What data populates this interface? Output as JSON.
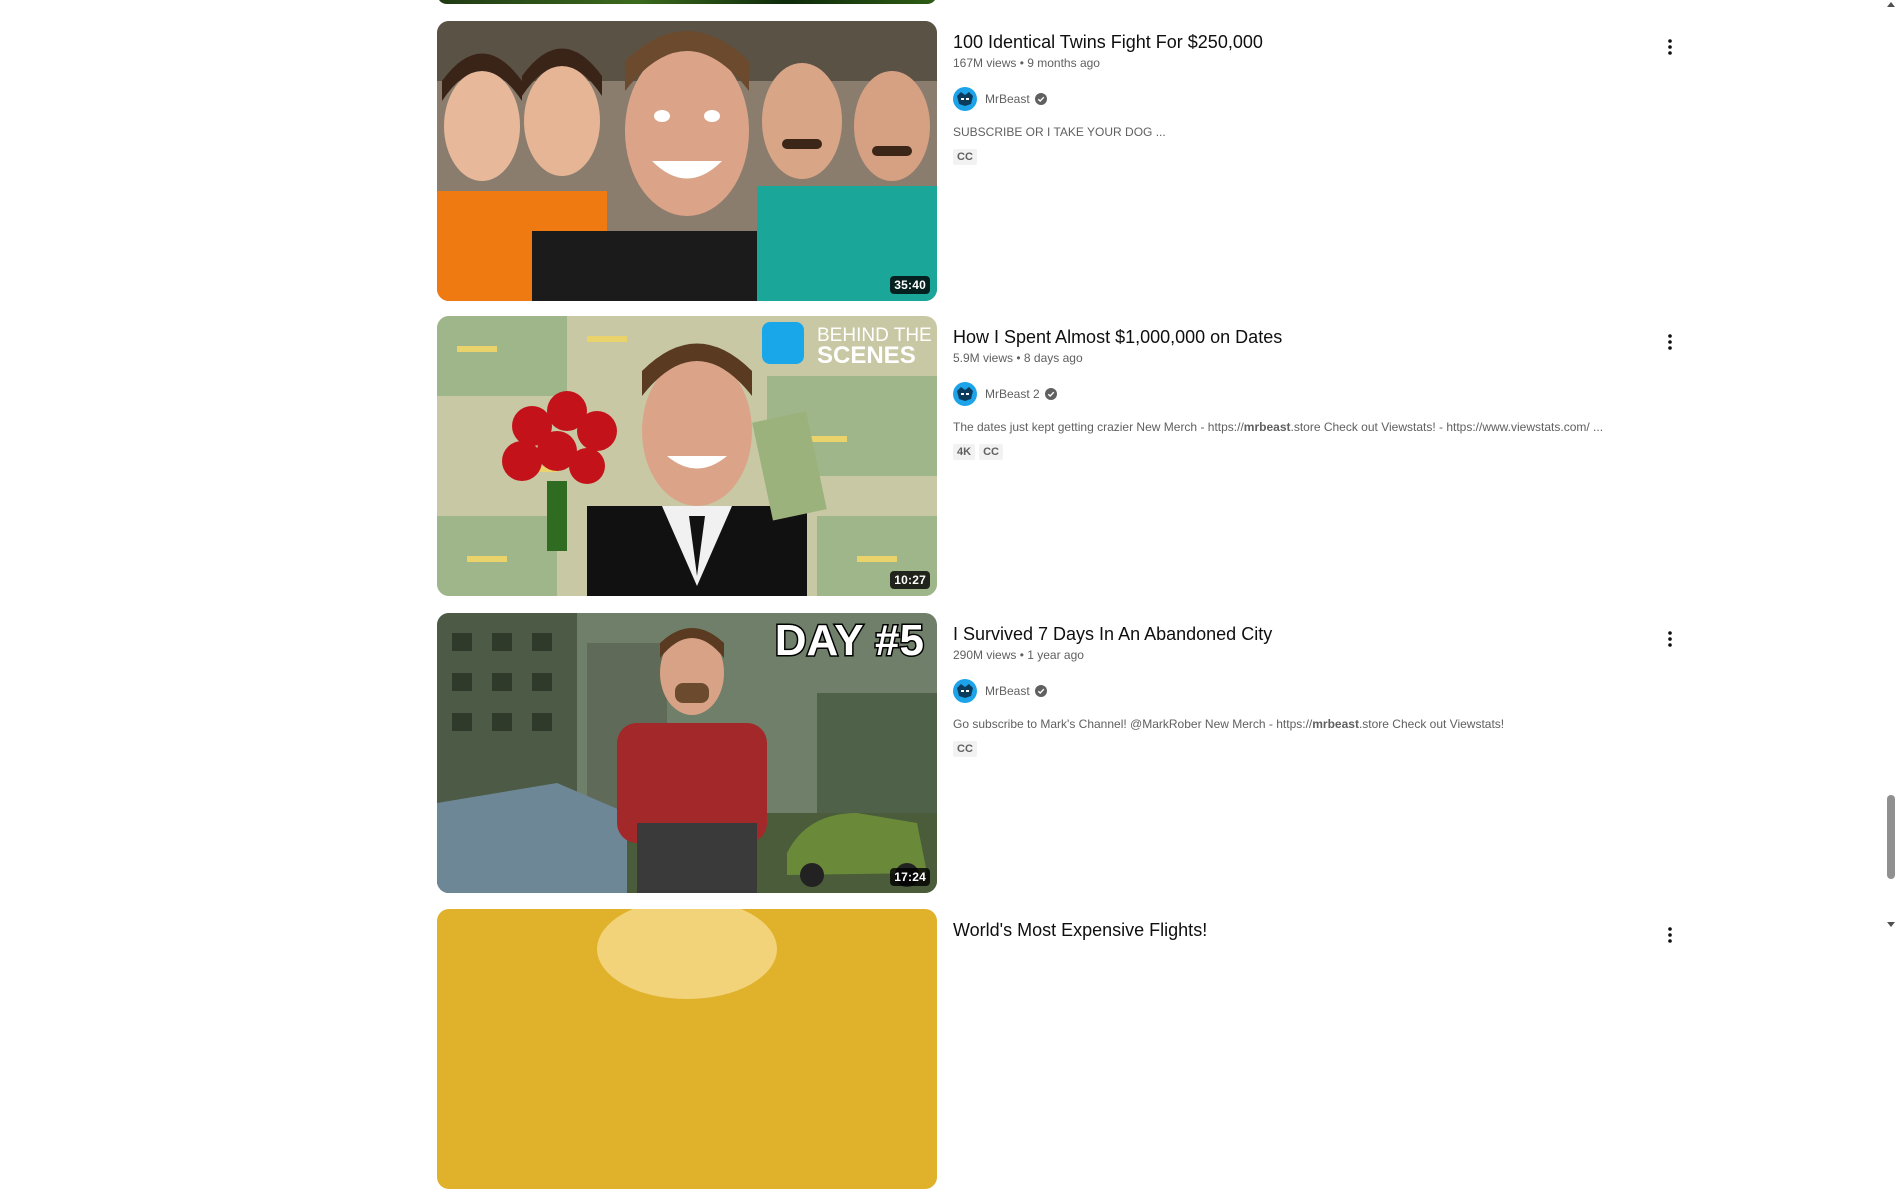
{
  "videos": [
    {
      "title": "100 Identical Twins Fight For $250,000",
      "views": "167M views",
      "age": "9 months ago",
      "channel": "MrBeast",
      "description": "SUBSCRIBE OR I TAKE YOUR DOG ...",
      "badges": [
        "CC"
      ],
      "duration": "35:40"
    },
    {
      "title": "How I Spent Almost $1,000,000 on Dates",
      "views": "5.9M views",
      "age": "8 days ago",
      "channel": "MrBeast 2",
      "description_pre": "The dates just kept getting crazier New Merch - https://",
      "description_bold": "mrbeast",
      "description_post": ".store Check out Viewstats! - https://www.viewstats.com/ ...",
      "badges": [
        "4K",
        "CC"
      ],
      "duration": "10:27",
      "thumb_overlay_line1": "BEHIND THE",
      "thumb_overlay_line2": "SCENES"
    },
    {
      "title": "I Survived 7 Days In An Abandoned City",
      "views": "290M views",
      "age": "1 year ago",
      "channel": "MrBeast",
      "description_pre": "Go subscribe to Mark's Channel! @MarkRober New Merch - https://",
      "description_bold": "mrbeast",
      "description_post": ".store Check out Viewstats!",
      "badges": [
        "CC"
      ],
      "duration": "17:24",
      "thumb_overlay": "DAY #5"
    },
    {
      "title": "World's Most Expensive Flights!"
    }
  ],
  "separator": "•",
  "icons": {
    "menu": "more-vert-icon",
    "verified": "verified-check-icon",
    "avatar": "mrbeast-logo-icon"
  },
  "colors": {
    "text_primary": "#0f0f0f",
    "text_secondary": "#606060",
    "badge_bg": "#f2f2f2",
    "avatar_bg": "#1da4e8"
  }
}
